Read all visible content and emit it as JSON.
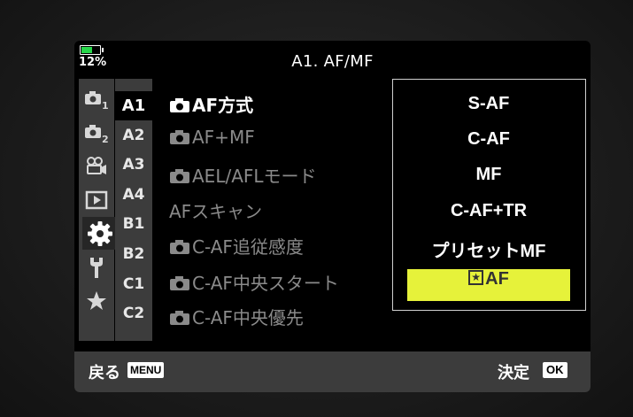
{
  "header": {
    "battery_percent": "12%",
    "battery_level": 0.12,
    "title": "A1. AF/MF"
  },
  "categories": [
    {
      "icon": "camera-1-icon",
      "label": "1"
    },
    {
      "icon": "camera-2-icon",
      "label": "2"
    },
    {
      "icon": "video-camera-icon",
      "label": ""
    },
    {
      "icon": "playback-icon",
      "label": ""
    },
    {
      "icon": "gear-icon",
      "label": "",
      "active": true
    },
    {
      "icon": "wrench-icon",
      "label": ""
    },
    {
      "icon": "star-icon",
      "label": ""
    }
  ],
  "subtabs": [
    "A1",
    "A2",
    "A3",
    "A4",
    "B1",
    "B2",
    "C1",
    "C2"
  ],
  "active_subtab": "A1",
  "items": [
    {
      "text": "AF方式",
      "camera_icon": true,
      "active": true
    },
    {
      "text": "AF+MF",
      "camera_icon": true
    },
    {
      "text": "AEL/AFLモード",
      "camera_icon": true
    },
    {
      "text": "AFスキャン",
      "camera_icon": false
    },
    {
      "text": "C-AF追従感度",
      "camera_icon": true
    },
    {
      "text": "C-AF中央スタート",
      "camera_icon": true
    },
    {
      "text": "C-AF中央優先",
      "camera_icon": true
    }
  ],
  "popup": {
    "options": [
      "S-AF",
      "C-AF",
      "MF",
      "C-AF+TR",
      "プリセットMF",
      "AF"
    ],
    "selected_index": 5,
    "selected_prefix_icon": "star-af-icon"
  },
  "footer": {
    "back_label": "戻る",
    "menu_button": "MENU",
    "confirm_label": "決定",
    "ok_button": "OK"
  },
  "colors": {
    "highlight": "#e6f23a",
    "battery": "#27d64a",
    "panel": "#3c3c3c"
  }
}
